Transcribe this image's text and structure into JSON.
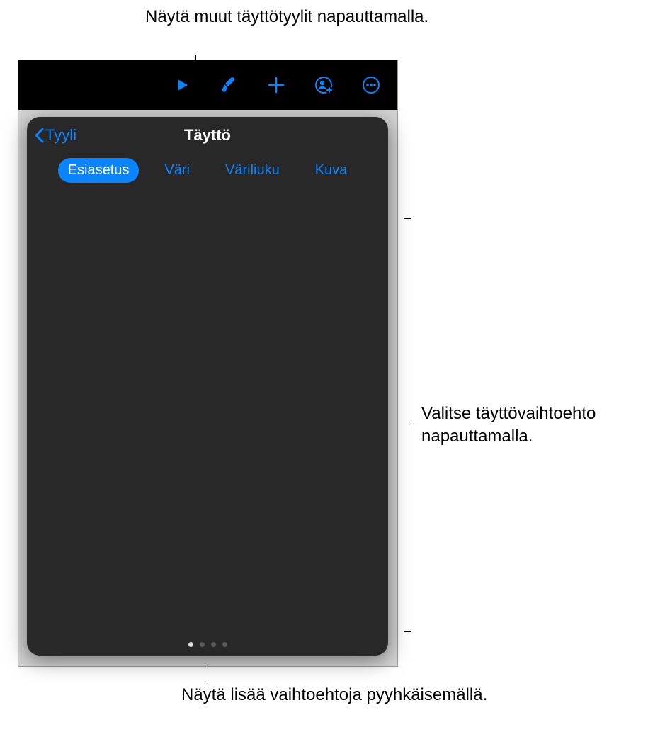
{
  "callouts": {
    "top": "Näytä muut täyttötyylit napauttamalla.",
    "right": "Valitse täyttövaihtoehto napauttamalla.",
    "bottom": "Näytä lisää vaihtoehtoja pyyhkäisemällä."
  },
  "toolbar": {
    "icons": [
      "play-icon",
      "format-brush-icon",
      "add-icon",
      "collaborate-icon",
      "more-icon"
    ]
  },
  "popover": {
    "back_label": "Tyyli",
    "title": "Täyttö",
    "tabs": [
      {
        "label": "Esiasetus",
        "active": true
      },
      {
        "label": "Väri",
        "active": false
      },
      {
        "label": "Väriliuku",
        "active": false
      },
      {
        "label": "Kuva",
        "active": false
      }
    ],
    "selected_index": [
      1,
      2
    ],
    "page_count": 4,
    "active_page": 0,
    "swatches": [
      [
        [
          "#1ba1ff",
          "#0079cc",
          "#00619e",
          "#004b7a"
        ],
        [
          "#13d4c5",
          "#00a99a",
          "#008a7d",
          "#006e63"
        ],
        [
          "#63e24a",
          "#3fbf2a",
          "#19981a",
          "#006e12"
        ]
      ],
      [
        [
          "#ffe738",
          "#f6c300",
          "#e89800",
          "#d46d00"
        ],
        [
          "#ea3f36",
          "#c9201c",
          "#a60e0e",
          "#7f0606"
        ],
        [
          "#f55ab0",
          "#d53394",
          "#ab1d77",
          "#7e105a"
        ]
      ]
    ]
  },
  "accent": "#0a84ff"
}
